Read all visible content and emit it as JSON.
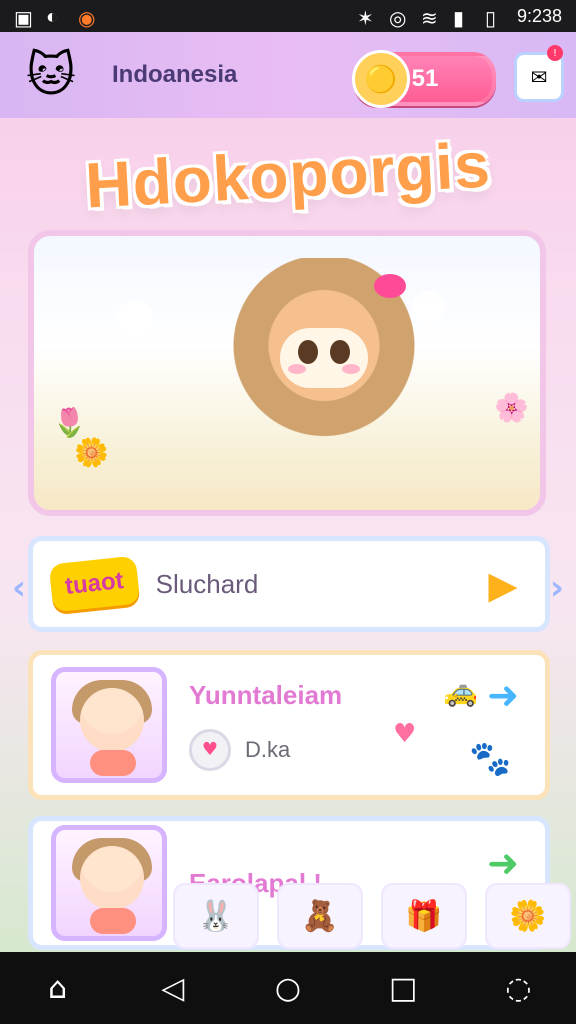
{
  "status_bar": {
    "time": "9:238"
  },
  "header": {
    "region": "Indoanesia",
    "coins": "51",
    "chat_badge": "!"
  },
  "title_logo": "Hdokoporgis",
  "menu": {
    "row1": {
      "tag": "tuaot",
      "title": "Sluchard"
    },
    "row2": {
      "title": "Yunntaleiam",
      "sub": "D.ka"
    },
    "row3": {
      "title": "Earolapal !"
    }
  },
  "icons": {
    "status_left": [
      "gallery-icon",
      "shield-icon",
      "orange-badge-icon"
    ],
    "status_right": [
      "bluetooth-icon",
      "location-icon",
      "wifi-icon",
      "signal-icon",
      "battery-icon"
    ],
    "nav": [
      "home-icon",
      "back-icon",
      "home-circle-icon",
      "recent-apps-icon",
      "profile-icon"
    ]
  }
}
